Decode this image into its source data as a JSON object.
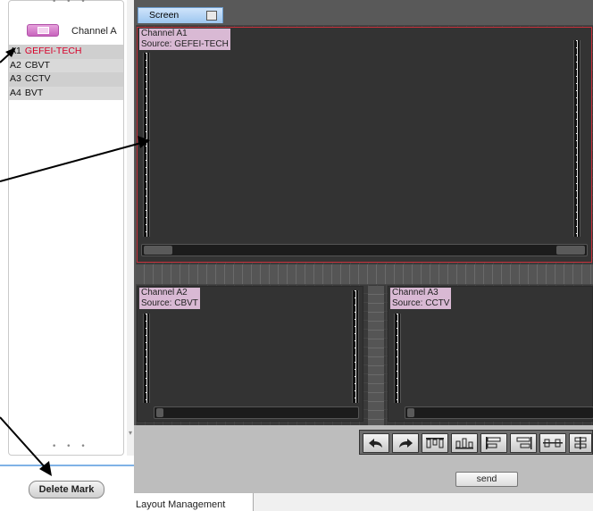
{
  "left_panel": {
    "channel_header": "Channel A",
    "channels": [
      {
        "id": "A1",
        "name": "GEFEI-TECH",
        "active": true
      },
      {
        "id": "A2",
        "name": "CBVT",
        "active": false
      },
      {
        "id": "A3",
        "name": "CCTV",
        "active": false
      },
      {
        "id": "A4",
        "name": "BVT",
        "active": false
      }
    ],
    "delete_button": "Delete Mark"
  },
  "screen_tab": "Screen",
  "windows": [
    {
      "title": "Channel A1",
      "source": "Source: GEFEI-TECH",
      "selected": true
    },
    {
      "title": "Channel A2",
      "source": "Source: CBVT",
      "selected": false
    },
    {
      "title": "Channel A3",
      "source": "Source: CCTV",
      "selected": false
    }
  ],
  "toolbar": {
    "icons": [
      "undo-icon",
      "redo-icon",
      "align-top-icon",
      "align-bottom-icon",
      "align-left-icon",
      "align-right-icon",
      "distribute-horizontal-icon",
      "distribute-vertical-icon"
    ]
  },
  "send_button": "send",
  "bottom_tab": "Layout Management",
  "colors": {
    "accent_pink": "#c864bd",
    "active_channel": "#d8002a",
    "selection_red": "#c8323c",
    "workspace": "#595959"
  }
}
